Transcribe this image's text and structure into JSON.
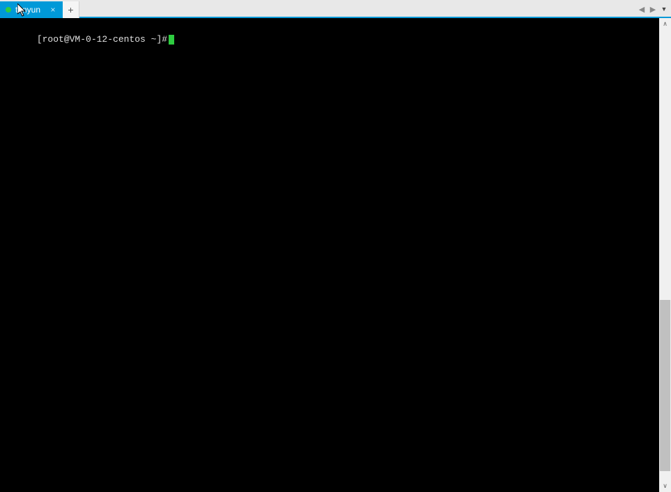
{
  "tabs": [
    {
      "label": "tenyun",
      "status": "connected"
    }
  ],
  "nav": {
    "prev_glyph": "◀",
    "next_glyph": "▶",
    "dropdown_glyph": "▼"
  },
  "newtab_glyph": "+",
  "close_glyph": "×",
  "terminal": {
    "prompt": "[root@VM-0-12-centos ~]#"
  },
  "scroll": {
    "up_glyph": "∧",
    "down_glyph": "∨"
  }
}
